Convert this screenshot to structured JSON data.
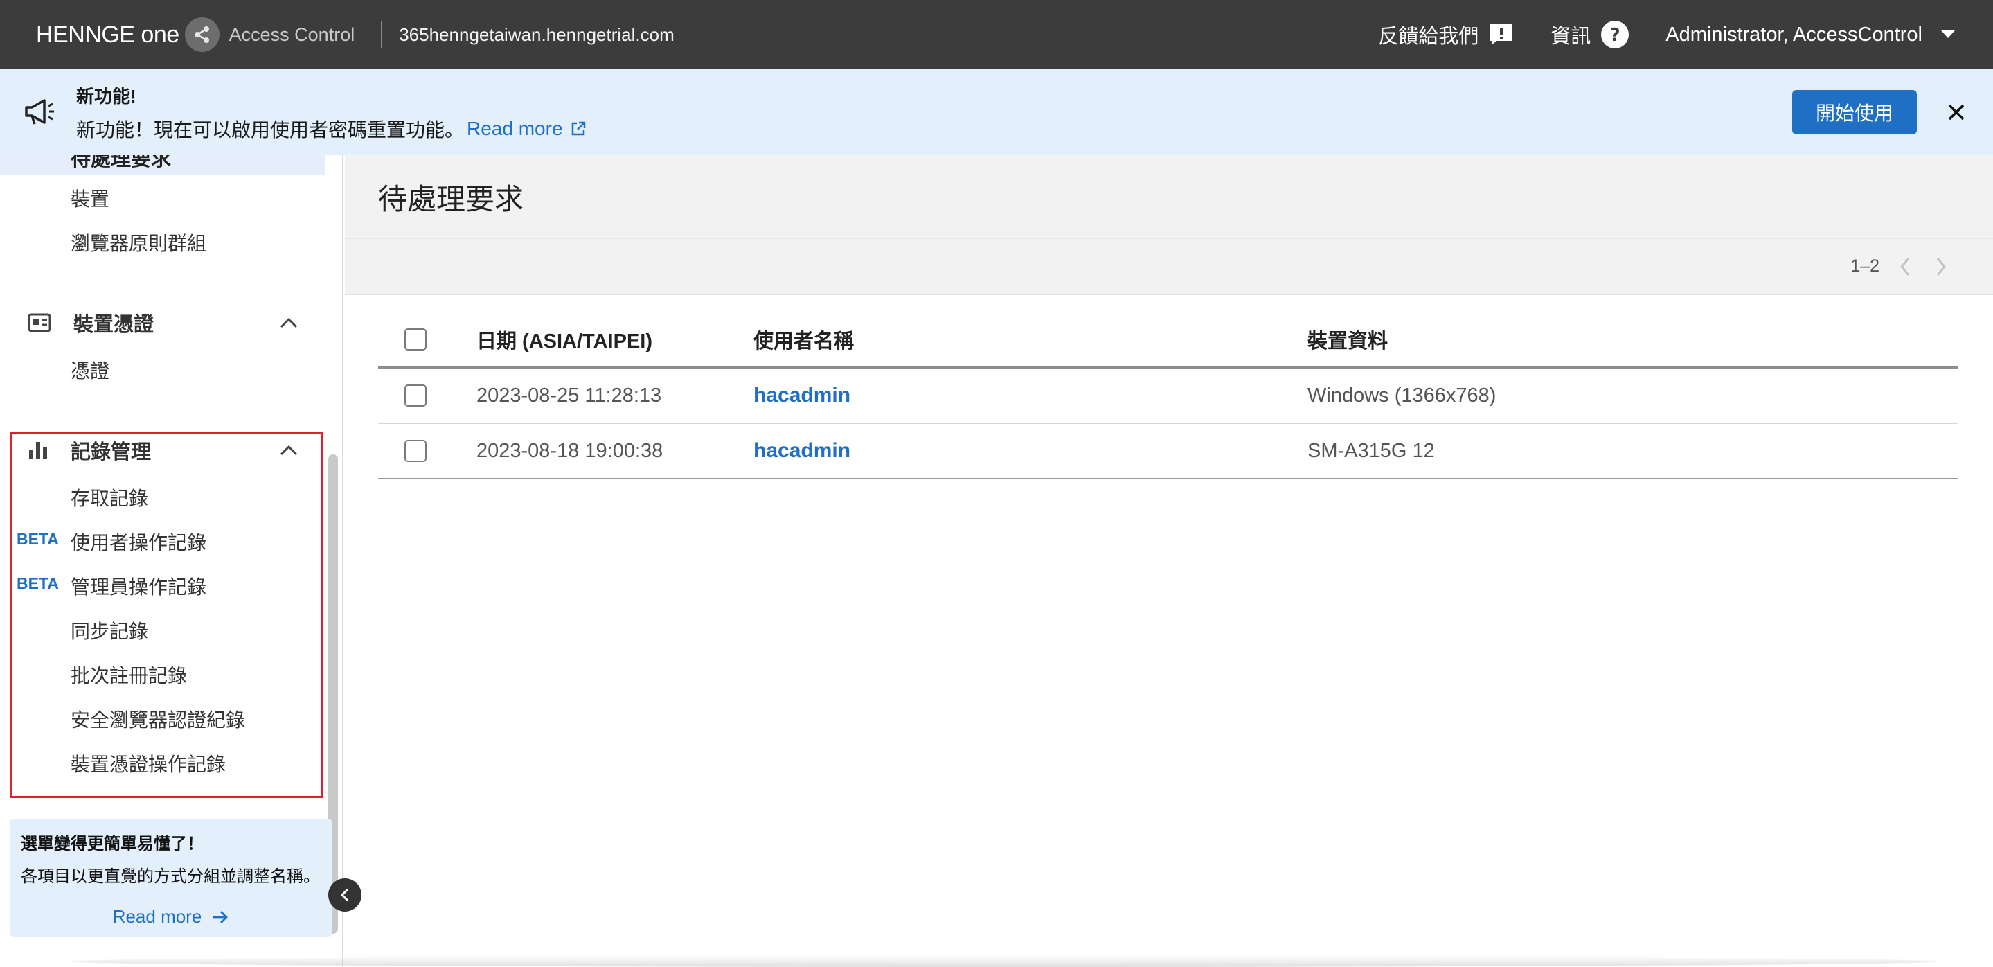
{
  "topbar": {
    "logo_text": "HENNGE one",
    "product": "Access Control",
    "tenant": "365henngetaiwan.henngetrial.com",
    "feedback_label": "反饋給我們",
    "info_label": "資訊",
    "user_label": "Administrator, AccessControl"
  },
  "announcement": {
    "title": "新功能!",
    "body": "新功能！現在可以啟用使用者密碼重置功能。",
    "read_more": "Read more",
    "start_button": "開始使用"
  },
  "sidebar": {
    "partial_item": "待處理要求",
    "items_top": [
      "裝置",
      "瀏覽器原則群組"
    ],
    "sections": [
      {
        "title": "裝置憑證",
        "items": [
          "憑證"
        ]
      },
      {
        "title": "記錄管理",
        "items": [
          "存取記錄",
          "使用者操作記錄",
          "管理員操作記錄",
          "同步記錄",
          "批次註冊記錄",
          "安全瀏覽器認證紀錄",
          "裝置憑證操作記錄"
        ]
      }
    ],
    "beta_label": "BETA",
    "promo": {
      "title": "選單變得更簡單易懂了！",
      "body": "各項目以更直覺的方式分組並調整名稱。",
      "link": "Read more"
    }
  },
  "main": {
    "title": "待處理要求",
    "pager": "1–2",
    "columns": [
      "日期 (ASIA/TAIPEI)",
      "使用者名稱",
      "裝置資料"
    ],
    "rows": [
      {
        "date": "2023-08-25 11:28:13",
        "user": "hacadmin",
        "device": "Windows (1366x768)"
      },
      {
        "date": "2023-08-18 19:00:38",
        "user": "hacadmin",
        "device": "SM-A315G 12"
      }
    ]
  },
  "colors": {
    "topbar": "#3c3c3c",
    "accent": "#1f6fc5",
    "announce_bg": "#e3f0fb",
    "highlight": "#e0202a"
  }
}
